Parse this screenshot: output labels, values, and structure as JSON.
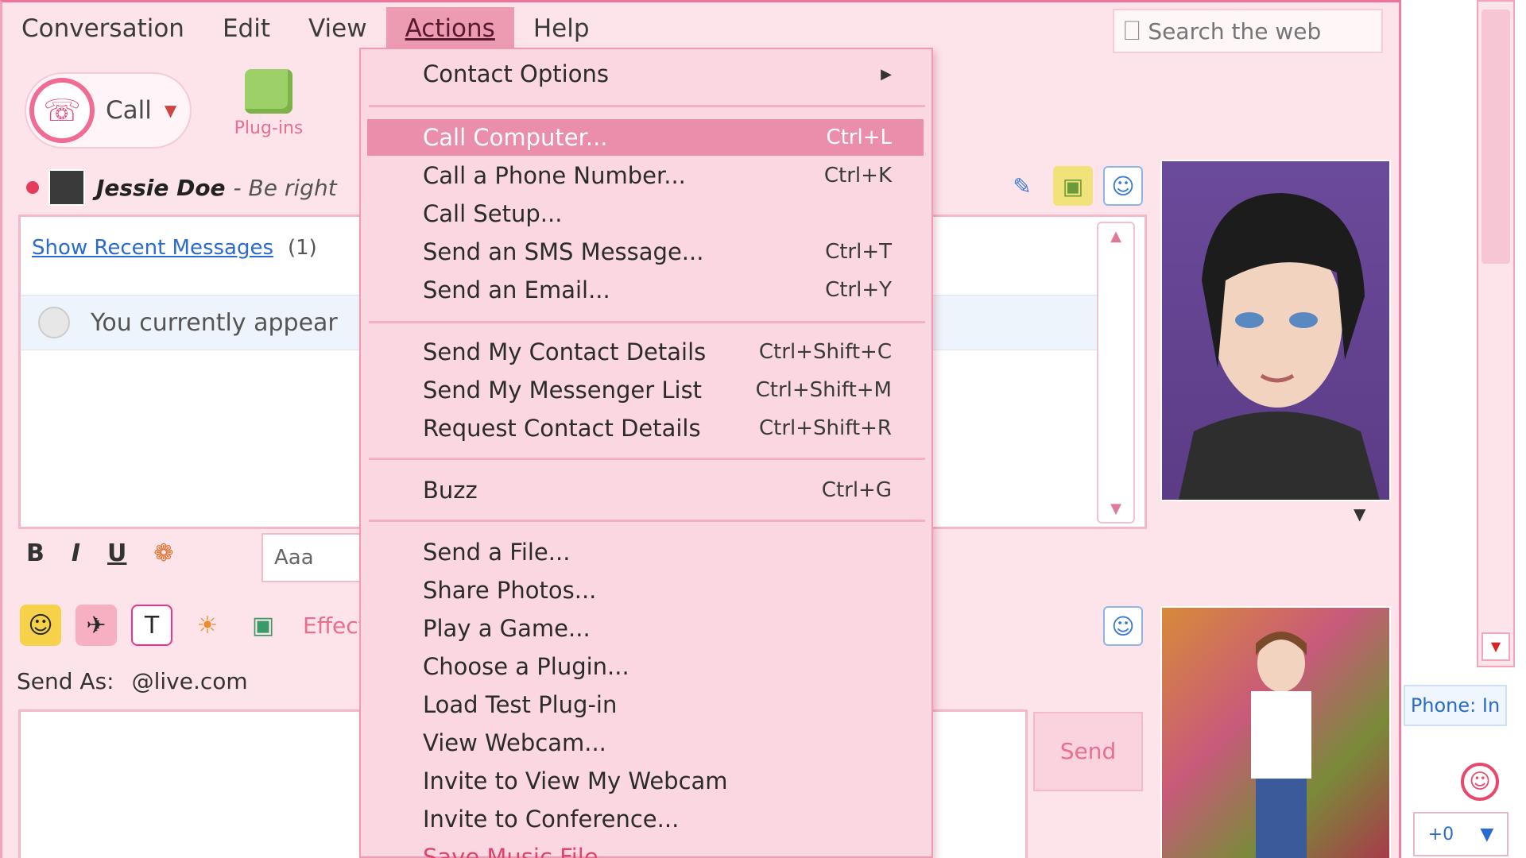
{
  "menubar": {
    "items": [
      "Conversation",
      "Edit",
      "View",
      "Actions",
      "Help"
    ],
    "active": "Actions"
  },
  "search": {
    "placeholder": "Search the web"
  },
  "toolbar": {
    "call_label": "Call",
    "plugins_label": "Plug-ins"
  },
  "contact": {
    "name": "Jessie Doe",
    "status": "- Be right"
  },
  "conversation": {
    "recent_link": "Show Recent Messages",
    "recent_count": "(1)",
    "notice": "You currently appear"
  },
  "format": {
    "bold": "B",
    "italic": "I",
    "underline": "U",
    "font_sample": "Aaa",
    "emote_label": "Effects"
  },
  "send_as": {
    "label": "Send As:",
    "account": "@live.com"
  },
  "send_button": "Send",
  "phone_tab": "Phone: In",
  "zoom": {
    "value": "+0"
  },
  "actions_menu": {
    "items": [
      {
        "label": "Contact Options",
        "shortcut": "",
        "submenu": true
      },
      {
        "label": "Call Computer...",
        "shortcut": "Ctrl+L",
        "highlighted": true
      },
      {
        "label": "Call a Phone Number...",
        "shortcut": "Ctrl+K"
      },
      {
        "label": "Call Setup...",
        "shortcut": ""
      },
      {
        "label": "Send an SMS Message...",
        "shortcut": "Ctrl+T"
      },
      {
        "label": "Send an Email...",
        "shortcut": "Ctrl+Y"
      },
      {
        "label": "Send My Contact Details",
        "shortcut": "Ctrl+Shift+C"
      },
      {
        "label": "Send My Messenger List",
        "shortcut": "Ctrl+Shift+M"
      },
      {
        "label": "Request Contact Details",
        "shortcut": "Ctrl+Shift+R"
      },
      {
        "label": "Buzz",
        "shortcut": "Ctrl+G"
      },
      {
        "label": "Send a File...",
        "shortcut": ""
      },
      {
        "label": "Share Photos...",
        "shortcut": ""
      },
      {
        "label": "Play a Game...",
        "shortcut": ""
      },
      {
        "label": "Choose a Plugin...",
        "shortcut": ""
      },
      {
        "label": "Load Test Plug-in",
        "shortcut": ""
      },
      {
        "label": "View Webcam...",
        "shortcut": ""
      },
      {
        "label": "Invite to View My Webcam",
        "shortcut": ""
      },
      {
        "label": "Invite to Conference...",
        "shortcut": ""
      },
      {
        "label": "Save Music File",
        "shortcut": ""
      }
    ]
  },
  "colors": {
    "window_bg": "#fde4ea",
    "accent": "#ef7497",
    "highlight": "#ea8eac",
    "link": "#2a6bd0"
  }
}
